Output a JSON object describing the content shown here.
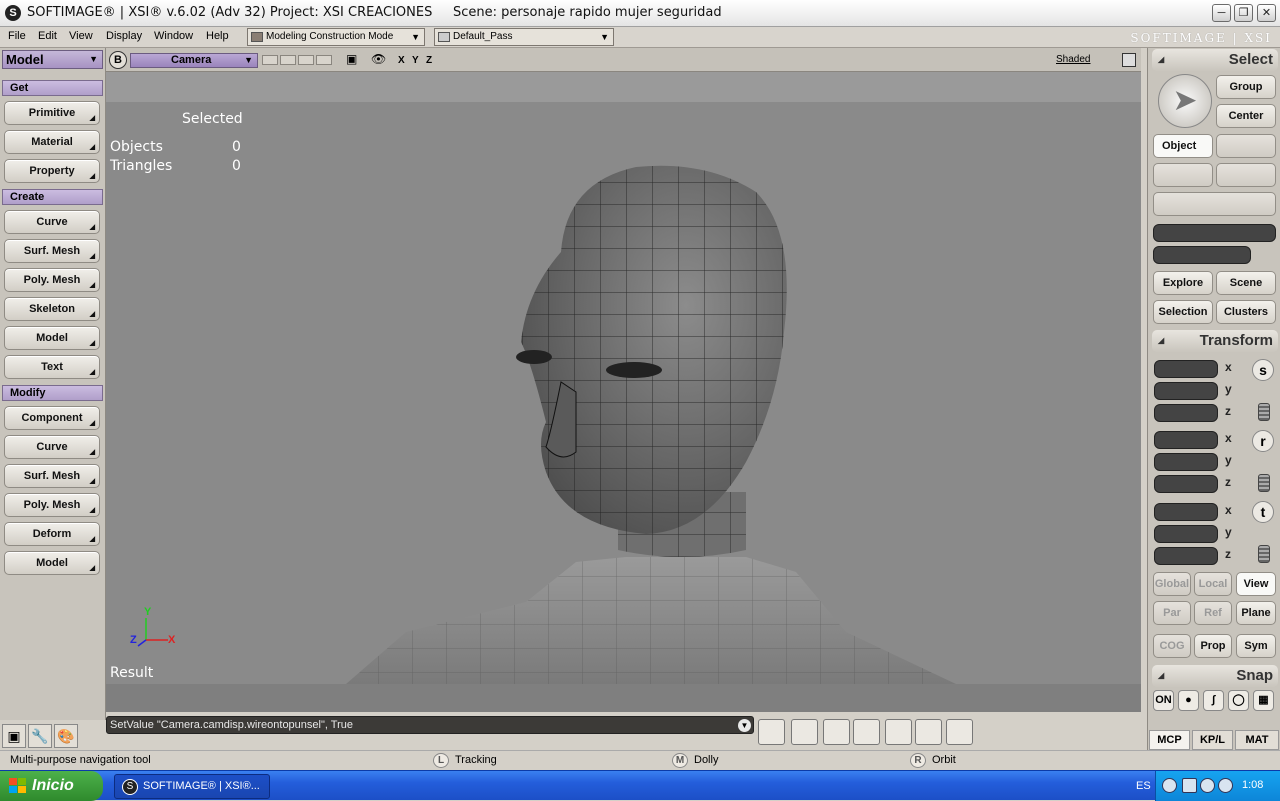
{
  "window": {
    "title": "SOFTIMAGE® | XSI® v.6.02 (Adv 32) Project: XSI CREACIONES     Scene: personaje rapido mujer seguridad",
    "brand": "SOFTIMAGE | XSI"
  },
  "menu": {
    "items": [
      "File",
      "Edit",
      "View",
      "Display",
      "Window",
      "Help"
    ],
    "mode_dropdown": "Modeling Construction Mode",
    "pass_dropdown": "Default_Pass"
  },
  "left_panel": {
    "mode": "Model",
    "sections": [
      {
        "header": "Get",
        "buttons": [
          "Primitive",
          "Material",
          "Property"
        ]
      },
      {
        "header": "Create",
        "buttons": [
          "Curve",
          "Surf. Mesh",
          "Poly. Mesh",
          "Skeleton",
          "Model",
          "Text"
        ]
      },
      {
        "header": "Modify",
        "buttons": [
          "Component",
          "Curve",
          "Surf. Mesh",
          "Poly. Mesh",
          "Deform",
          "Model"
        ]
      }
    ]
  },
  "viewport": {
    "b_button": "B",
    "camera": "Camera",
    "axes_letters": [
      "X",
      "Y",
      "Z"
    ],
    "display_mode": "Shaded",
    "selected_label": "Selected",
    "stats": [
      {
        "label": "Objects",
        "value": "0"
      },
      {
        "label": "Triangles",
        "value": "0"
      }
    ],
    "result_label": "Result",
    "axis_gizmo": {
      "y": "Y",
      "x": "X",
      "z": "Z"
    }
  },
  "command_bar": {
    "text": "SetValue \"Camera.camdisp.wireontopunsel\", True"
  },
  "status_bar": {
    "hint": "Multi-purpose navigation tool",
    "mouse": [
      {
        "key": "L",
        "label": "Tracking"
      },
      {
        "key": "M",
        "label": "Dolly"
      },
      {
        "key": "R",
        "label": "Orbit"
      }
    ]
  },
  "right_panel": {
    "select_header": "Select",
    "group_btn": "Group",
    "center_btn": "Center",
    "object_btn": "Object",
    "explore_btn": "Explore",
    "scene_btn": "Scene",
    "selection_btn": "Selection",
    "clusters_btn": "Clusters",
    "transform_header": "Transform",
    "axes": [
      "x",
      "y",
      "z"
    ],
    "transform_icons": [
      "s",
      "r",
      "t"
    ],
    "ref_buttons": [
      "Global",
      "Local",
      "View",
      "Par",
      "Ref",
      "Plane"
    ],
    "cog_btn": "COG",
    "prop_btn": "Prop",
    "sym_btn": "Sym",
    "snap_header": "Snap",
    "snap_on": "ON",
    "bottom_tabs": [
      "MCP",
      "KP/L",
      "MAT"
    ]
  },
  "taskbar": {
    "start": "Inicio",
    "task_item": "SOFTIMAGE® | XSI®...",
    "language": "ES",
    "clock": "1:08"
  },
  "colors": {
    "viewport_bg": "#8a8a8a",
    "section_header": "#b09fca",
    "taskbar": "#245edb",
    "start_green": "#3c9b3a"
  }
}
